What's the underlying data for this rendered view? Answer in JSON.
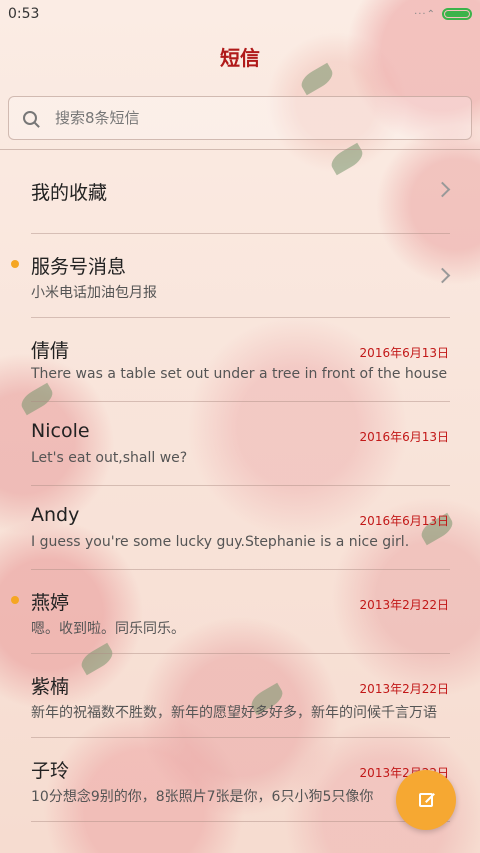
{
  "status_bar": {
    "time": "0:53"
  },
  "header": {
    "title": "短信"
  },
  "search": {
    "placeholder": "搜索8条短信"
  },
  "favorites": {
    "label": "我的收藏"
  },
  "service": {
    "label": "服务号消息",
    "preview": "小米电话加油包月报",
    "unread": true
  },
  "conversations": [
    {
      "name": "倩倩",
      "date": "2016年6月13日",
      "preview": "There was a table set out under a tree in front of the house",
      "unread": false
    },
    {
      "name": "Nicole",
      "date": "2016年6月13日",
      "preview": "Let's eat out,shall we?",
      "unread": false
    },
    {
      "name": "Andy",
      "date": "2016年6月13日",
      "preview": "I guess you're some lucky guy.Stephanie is a nice girl.",
      "unread": false
    },
    {
      "name": "燕婷",
      "date": "2013年2月22日",
      "preview": "嗯。收到啦。同乐同乐。",
      "unread": true
    },
    {
      "name": "紫楠",
      "date": "2013年2月22日",
      "preview": "新年的祝福数不胜数，新年的愿望好多好多，新年的问候千言万语",
      "unread": false
    },
    {
      "name": "子玲",
      "date": "2013年2月22日",
      "preview": "10分想念9别的你，8张照片7张是你，6只小狗5只像你",
      "unread": false
    }
  ],
  "colors": {
    "accent": "#b01a1a",
    "date": "#c21818",
    "fab": "#f6a832",
    "unread_dot": "#f5a623"
  }
}
